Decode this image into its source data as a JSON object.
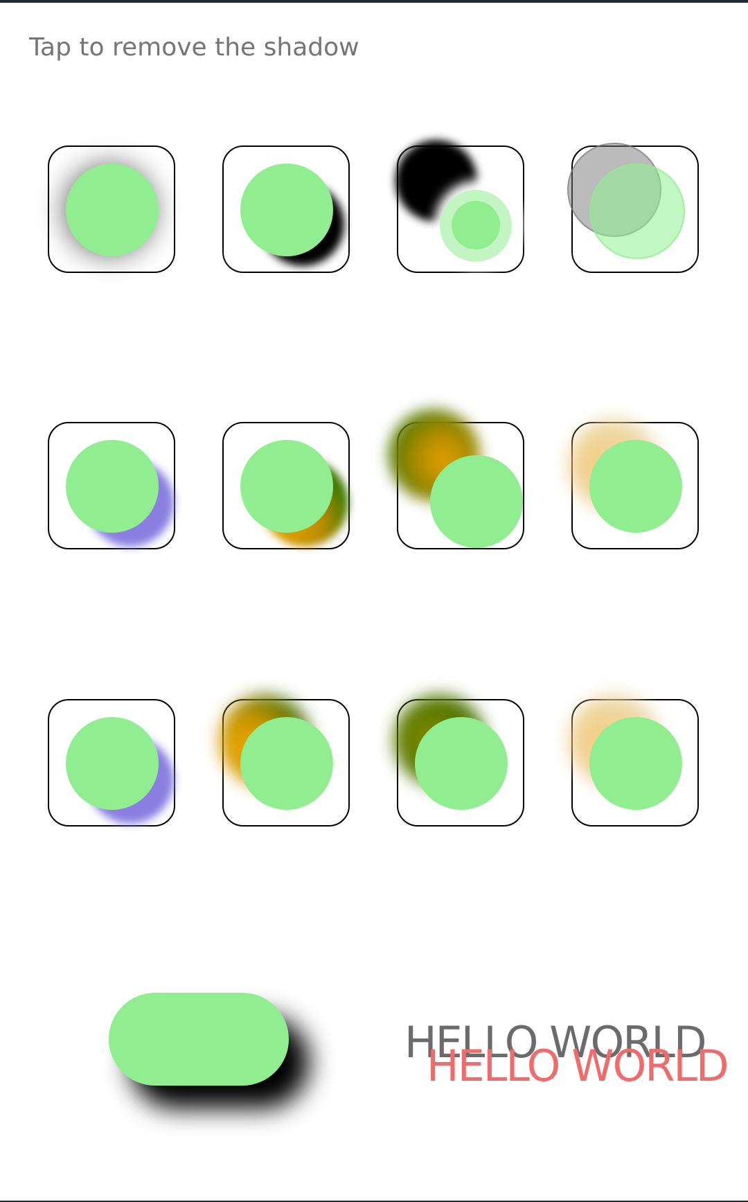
{
  "hint_text": "Tap to remove the shadow",
  "text_demo": {
    "primary": "HELLO WORLD",
    "shadow": "HELLO WORLD"
  },
  "colors": {
    "dot": "#90ee90",
    "border": "#000000",
    "hint": "#757575",
    "text_primary": "#6b6b6b",
    "text_shadow": "#f06c6c",
    "shadow_black": "#000000",
    "shadow_purple": "#8a7ee0",
    "shadow_orange_green": "#c39a00",
    "shadow_tan": "#ead29a"
  },
  "grid": {
    "rows": 3,
    "cols": 4
  }
}
